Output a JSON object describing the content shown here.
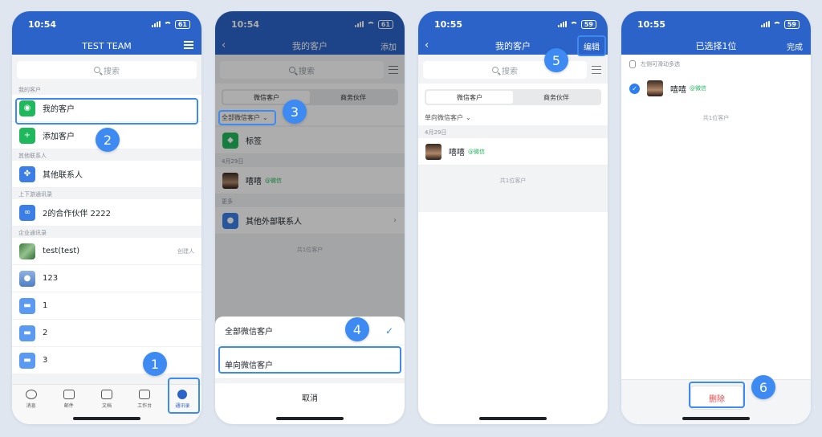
{
  "status": {
    "time1": "10:54",
    "time2": "10:54",
    "time3": "10:55",
    "time4": "10:55",
    "battery": "61",
    "battery2": "59"
  },
  "screen1": {
    "title": "TEST TEAM",
    "search_placeholder": "搜索",
    "sec_my": "我的客户",
    "my_customers": "我的客户",
    "add_customer": "添加客户",
    "sec_other": "其他联系人",
    "other_contacts": "其他联系人",
    "sec_upstream": "上下游通讯录",
    "partner": "2的合作伙伴 2222",
    "sec_company": "企业通讯录",
    "rows": [
      {
        "name": "test(test)",
        "tag": "创建人"
      },
      {
        "name": "123"
      },
      {
        "name": "1"
      },
      {
        "name": "2"
      },
      {
        "name": "3"
      }
    ],
    "tabs": [
      "消息",
      "邮件",
      "文档",
      "工作台",
      "通讯录"
    ]
  },
  "screen2": {
    "title": "我的客户",
    "add": "添加",
    "search_placeholder": "搜索",
    "seg_wechat": "微信客户",
    "seg_partner": "商务伙伴",
    "filter": "全部微信客户",
    "tags": "标签",
    "date": "4月29日",
    "contact": "嘻嘻",
    "wx_suffix": "@微信",
    "more": "更多",
    "other_external": "其他外部联系人",
    "count": "共1位客户",
    "sheet_all": "全部微信客户",
    "sheet_oneway": "单向微信客户",
    "cancel": "取消"
  },
  "screen3": {
    "title": "我的客户",
    "edit": "编辑",
    "search_placeholder": "搜索",
    "seg_wechat": "微信客户",
    "seg_partner": "商务伙伴",
    "filter": "单向微信客户",
    "date": "4月29日",
    "contact": "嘻嘻",
    "wx_suffix": "@微信",
    "count": "共1位客户"
  },
  "screen4": {
    "title": "已选择1位",
    "done": "完成",
    "hint": "左侧可滑动多选",
    "contact": "嘻嘻",
    "wx_suffix": "@微信",
    "count": "共1位客户",
    "delete": "删除"
  },
  "steps": [
    "1",
    "2",
    "3",
    "4",
    "5",
    "6"
  ],
  "colors": {
    "primary": "#2b63c9",
    "accent": "#3d8bf2",
    "wechat": "#1fb85c",
    "danger": "#e84a4a"
  }
}
